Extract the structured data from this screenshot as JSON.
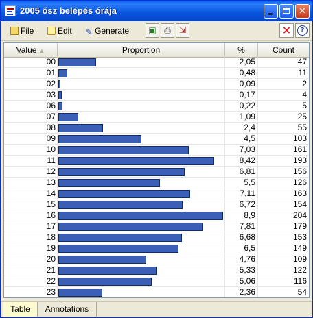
{
  "window": {
    "title": "2005 ősz belépés órája"
  },
  "menu": {
    "file": "File",
    "edit": "Edit",
    "generate": "Generate"
  },
  "icons": {
    "app": "chart-window-icon",
    "toolbar": [
      "view-icon",
      "print-icon",
      "export-icon"
    ],
    "close_output": "close-icon",
    "help": "help-icon",
    "sort": "sort-ascending-icon"
  },
  "colors": {
    "bar_fill": "#3a5fb4",
    "bar_border": "#152a6a",
    "title_bar": "#0a5ff0"
  },
  "table": {
    "columns": {
      "value": "Value",
      "proportion": "Proportion",
      "percent": "%",
      "count": "Count"
    },
    "rows": [
      {
        "value": "00",
        "pct": "2,05",
        "count": "47"
      },
      {
        "value": "01",
        "pct": "0,48",
        "count": "11"
      },
      {
        "value": "02",
        "pct": "0,09",
        "count": "2"
      },
      {
        "value": "03",
        "pct": "0,17",
        "count": "4"
      },
      {
        "value": "06",
        "pct": "0,22",
        "count": "5"
      },
      {
        "value": "07",
        "pct": "1,09",
        "count": "25"
      },
      {
        "value": "08",
        "pct": "2,4",
        "count": "55"
      },
      {
        "value": "09",
        "pct": "4,5",
        "count": "103"
      },
      {
        "value": "10",
        "pct": "7,03",
        "count": "161"
      },
      {
        "value": "11",
        "pct": "8,42",
        "count": "193"
      },
      {
        "value": "12",
        "pct": "6,81",
        "count": "156"
      },
      {
        "value": "13",
        "pct": "5,5",
        "count": "126"
      },
      {
        "value": "14",
        "pct": "7,11",
        "count": "163"
      },
      {
        "value": "15",
        "pct": "6,72",
        "count": "154"
      },
      {
        "value": "16",
        "pct": "8,9",
        "count": "204"
      },
      {
        "value": "17",
        "pct": "7,81",
        "count": "179"
      },
      {
        "value": "18",
        "pct": "6,68",
        "count": "153"
      },
      {
        "value": "19",
        "pct": "6,5",
        "count": "149"
      },
      {
        "value": "20",
        "pct": "4,76",
        "count": "109"
      },
      {
        "value": "21",
        "pct": "5,33",
        "count": "122"
      },
      {
        "value": "22",
        "pct": "5,06",
        "count": "116"
      },
      {
        "value": "23",
        "pct": "2,36",
        "count": "54"
      }
    ]
  },
  "tabs": {
    "table": "Table",
    "annotations": "Annotations"
  }
}
